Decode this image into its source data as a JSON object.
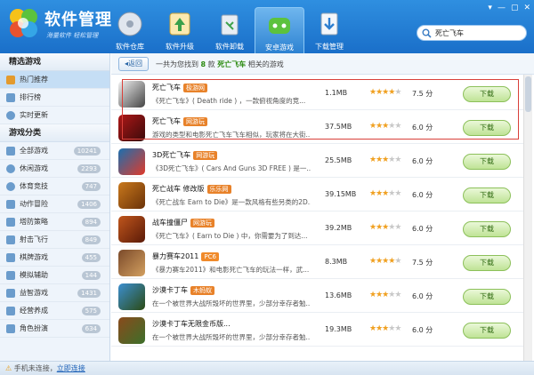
{
  "app": {
    "title": "软件管理",
    "subtitle": "海量软件 轻松管理"
  },
  "nav_tabs": [
    {
      "label": "软件仓库",
      "icon": "software-store-icon",
      "active": false
    },
    {
      "label": "软件升级",
      "icon": "software-upgrade-icon",
      "active": false
    },
    {
      "label": "软件卸载",
      "icon": "recycle-bin-icon",
      "active": false
    },
    {
      "label": "安卓游戏",
      "icon": "android-game-icon",
      "active": true
    },
    {
      "label": "下载管理",
      "icon": "download-manager-icon",
      "active": false
    }
  ],
  "window_controls": [
    "▾",
    "—",
    "▢",
    "✕"
  ],
  "search": {
    "value": "死亡飞车"
  },
  "sidebar": {
    "featured_heading": "精选游戏",
    "featured": [
      {
        "label": "热门推荐",
        "active": true
      },
      {
        "label": "排行榜",
        "active": false
      },
      {
        "label": "实时更新",
        "active": false
      }
    ],
    "category_heading": "游戏分类",
    "categories": [
      {
        "label": "全部游戏",
        "count": "10241"
      },
      {
        "label": "休闲游戏",
        "count": "2293"
      },
      {
        "label": "体育竞技",
        "count": "747"
      },
      {
        "label": "动作冒险",
        "count": "1406"
      },
      {
        "label": "塔防策略",
        "count": "894"
      },
      {
        "label": "射击飞行",
        "count": "849"
      },
      {
        "label": "棋牌游戏",
        "count": "455"
      },
      {
        "label": "模拟辅助",
        "count": "144"
      },
      {
        "label": "益智游戏",
        "count": "1431"
      },
      {
        "label": "经营养成",
        "count": "575"
      },
      {
        "label": "角色扮演",
        "count": "634"
      }
    ]
  },
  "toolbar": {
    "back_label": "返回",
    "result_prefix": "一共为您找到 ",
    "result_count": "8",
    "result_mid": " 款 ",
    "result_keyword": "死亡飞车",
    "result_suffix": " 相关的游戏"
  },
  "results": [
    {
      "title": "死亡飞车",
      "tag": "极游网",
      "tag_color": "#e8822a",
      "desc": "《死亡飞车》( Death ride ) ，一款俯视角度的竞...",
      "size": "1.1MB",
      "rating": 4,
      "score": "7.5 分",
      "button": "下载"
    },
    {
      "title": "死亡飞车",
      "tag": "网游玩",
      "tag_color": "#e8822a",
      "desc": "游戏的类型和电影死亡飞车飞车相似，玩家将在大街...",
      "size": "37.5MB",
      "rating": 3,
      "score": "6.0 分",
      "button": "下载"
    },
    {
      "title": "3D死亡飞车",
      "tag": "网游玩",
      "tag_color": "#e8822a",
      "desc": "《3D死亡飞车》( Cars And Guns 3D FREE ) 是一...",
      "size": "25.5MB",
      "rating": 3,
      "score": "6.0 分",
      "button": "下载"
    },
    {
      "title": "死亡战车 修改版",
      "tag": "乐乐网",
      "tag_color": "#e8822a",
      "desc": "《死亡战车 Earn to Die》是一款风格有些另类的2D...",
      "size": "39.15MB",
      "rating": 3,
      "score": "6.0 分",
      "button": "下载"
    },
    {
      "title": "战车撞僵尸",
      "tag": "网游玩",
      "tag_color": "#e8822a",
      "desc": "《死亡飞车》( Earn to Die ) 中，你需要为了到达...",
      "size": "39.2MB",
      "rating": 3,
      "score": "6.0 分",
      "button": "下载"
    },
    {
      "title": "暴力赛车2011",
      "tag": "PC6",
      "tag_color": "#f08a2a",
      "desc": "《暴力赛车2011》和电影死亡飞车的玩法一样，武...",
      "size": "8.3MB",
      "rating": 4,
      "score": "7.5 分",
      "button": "下载"
    },
    {
      "title": "沙漠卡丁车",
      "tag": "木蚂蚁",
      "tag_color": "#e8822a",
      "desc": "在一个被世界大战所毁坏的世界里，少部分幸存者勉...",
      "size": "13.6MB",
      "rating": 3,
      "score": "6.0 分",
      "button": "下载"
    },
    {
      "title": "沙漠卡丁车无限金币版...",
      "tag": "",
      "tag_color": "#e8822a",
      "desc": "在一个被世界大战所毁坏的世界里，少部分幸存者勉...",
      "size": "19.3MB",
      "rating": 3,
      "score": "6.0 分",
      "button": "下载"
    }
  ],
  "status": {
    "text": "手机未连接，",
    "link": "立即连接"
  }
}
